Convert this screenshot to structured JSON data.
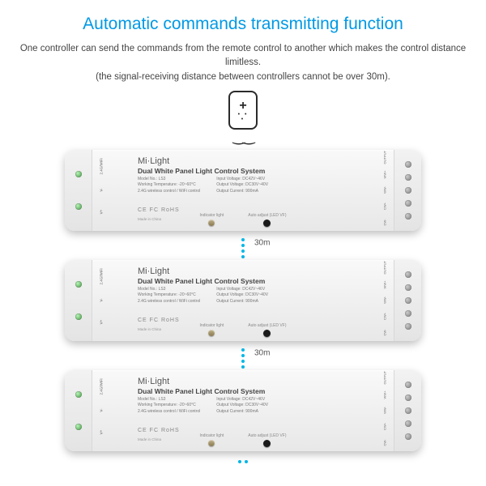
{
  "title": "Automatic commands transmitting function",
  "description_line1": "One controller can send the commands from the remote control to another which makes the control distance limitless.",
  "description_line2": "(the signal-receiving distance between controllers cannot be over 30m).",
  "distance_label": "30m",
  "controller": {
    "brand": "Mi·Light",
    "product": "Dual White Panel Light Control System",
    "left_specs": {
      "model": "Model No.: LS3",
      "temp": "Working Temperature: -20~60°C",
      "wireless": "2.4G wireless control / WiFi control"
    },
    "right_specs": {
      "vin": "Input Voltage: DC42V~46V",
      "vout": "Output Voltage: DC30V~40V",
      "iout": "Output Current: 900mA"
    },
    "cert": "CE FC RoHS",
    "made": "Made in China",
    "indicator_label": "Indicator light",
    "auto_label": "Auto adjust (LED VF)",
    "left_terminals": [
      "2.4G/WiFi",
      "--",
      "V-",
      "V+"
    ],
    "right_terminals": [
      "WW+",
      "WW-",
      "CW+",
      "CW-",
      "OUTPUT"
    ]
  }
}
